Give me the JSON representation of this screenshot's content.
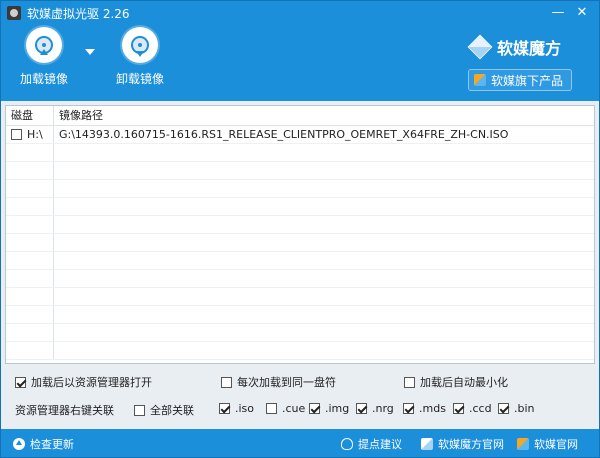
{
  "window": {
    "title": "软媒虚拟光驱 2.26",
    "minimize": "—",
    "close": "✕"
  },
  "toolbar": {
    "mount_label": "加载镜像",
    "unmount_label": "卸载镜像",
    "brand_name": "软媒魔方",
    "products_label": "软媒旗下产品"
  },
  "table": {
    "headers": {
      "drive": "磁盘",
      "path": "镜像路径"
    },
    "rows": [
      {
        "checked": false,
        "drive": "H:\\",
        "path": "G:\\14393.0.160715-1616.RS1_RELEASE_CLIENTPRO_OEMRET_X64FRE_ZH-CN.ISO"
      }
    ]
  },
  "options": {
    "open_explorer": {
      "label": "加载后以资源管理器打开",
      "checked": true
    },
    "same_drive": {
      "label": "每次加载到同一盘符",
      "checked": false
    },
    "auto_minimize": {
      "label": "加载后自动最小化",
      "checked": false
    },
    "context_menu_label": "资源管理器右键关联",
    "associate_all": {
      "label": "全部关联",
      "checked": false
    },
    "extensions": [
      {
        "label": ".iso",
        "checked": true
      },
      {
        "label": ".cue",
        "checked": false
      },
      {
        "label": ".img",
        "checked": true
      },
      {
        "label": ".nrg",
        "checked": true
      },
      {
        "label": ".mds",
        "checked": true
      },
      {
        "label": ".ccd",
        "checked": true
      },
      {
        "label": ".bin",
        "checked": true
      }
    ]
  },
  "statusbar": {
    "check_update": "检查更新",
    "suggest": "提点建议",
    "mofang_site": "软媒魔方官网",
    "ruanmei_site": "软媒官网"
  },
  "colors": {
    "accent": "#1c8fdb",
    "panel": "#e9eef3"
  }
}
